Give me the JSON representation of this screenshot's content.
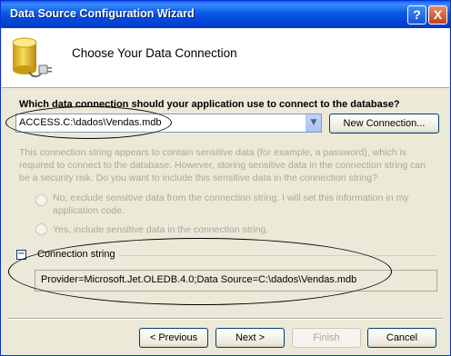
{
  "window": {
    "title": "Data Source Configuration Wizard",
    "help_glyph": "?",
    "close_glyph": "X"
  },
  "header": {
    "title": "Choose Your Data Connection",
    "icon": "database-plug-icon"
  },
  "question": "Which data connection should your application use to connect to the database?",
  "connection_combo": {
    "value": "ACCESS.C:\\dados\\Vendas.mdb",
    "dropdown_glyph": "▼"
  },
  "new_connection_label": "New Connection...",
  "description": "This connection string appears to contain sensitive data (for example, a password), which is required to connect to the database. However, storing sensitive data in the connection string can be a security risk. Do you want to include this sensitive data in the connection string?",
  "options": [
    {
      "label": "No, exclude sensitive data from the connection string. I will set this information in my application code."
    },
    {
      "label": "Yes, include sensitive data in the connection string."
    }
  ],
  "connection_string": {
    "toggle_glyph": "−",
    "label": "Connection string",
    "value": "Provider=Microsoft.Jet.OLEDB.4.0;Data Source=C:\\dados\\Vendas.mdb"
  },
  "footer": {
    "previous_label": "< Previous",
    "next_label": "Next >",
    "finish_label": "Finish",
    "cancel_label": "Cancel"
  },
  "colors": {
    "titlebar": "#0a59e6",
    "face": "#ece9d8",
    "disabled_text": "#aca899"
  }
}
